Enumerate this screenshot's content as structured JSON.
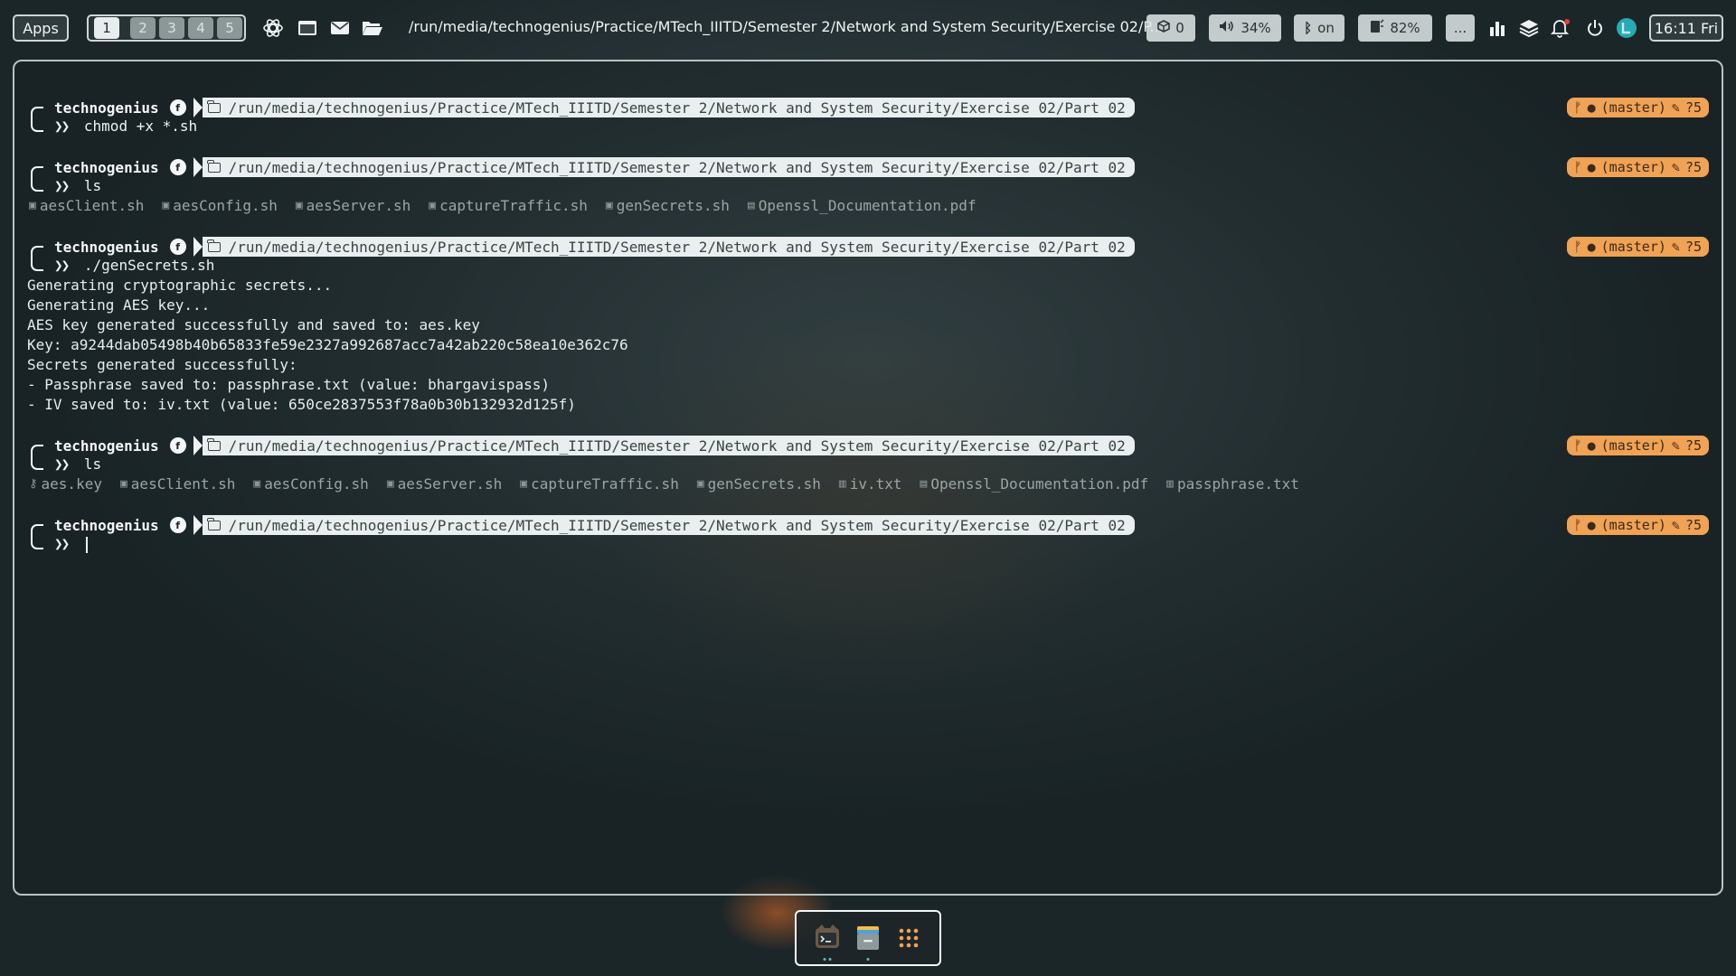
{
  "topbar": {
    "apps_label": "Apps",
    "workspaces": [
      "1",
      "2",
      "3",
      "4",
      "5"
    ],
    "active_workspace": "1",
    "launchers": [
      "openai-icon",
      "window-icon",
      "mail-icon",
      "folder-open-icon"
    ],
    "window_title": "/run/media/technogenius/Practice/MTech_IIITD/Semester 2/Network and System Security/Exercise 02/P...",
    "updates": "0",
    "volume": "34%",
    "bluetooth": "on",
    "brightness": "82%",
    "more": "...",
    "clock": "16:11 Fri"
  },
  "prompt": {
    "user": "technogenius",
    "path": "/run/media/technogenius/Practice/MTech_IIITD/Semester 2/Network and System Security/Exercise 02/Part 02",
    "git_branch": "(master)",
    "git_status": "?5",
    "symbol": "❯❯"
  },
  "blocks": [
    {
      "command": "chmod +x *.sh"
    },
    {
      "command": "ls",
      "files": [
        "aesClient.sh",
        "aesConfig.sh",
        "aesServer.sh",
        "captureTraffic.sh",
        "genSecrets.sh",
        "Openssl_Documentation.pdf"
      ]
    },
    {
      "command": "./genSecrets.sh",
      "output": [
        "Generating cryptographic secrets...",
        "Generating AES key...",
        "AES key generated successfully and saved to: aes.key",
        "Key: a9244dab05498b40b65833fe59e2327a992687acc7a42ab220c58ea10e362c76",
        "Secrets generated successfully:",
        "- Passphrase saved to: passphrase.txt (value: bhargavispass)",
        "- IV saved to: iv.txt (value: 650ce2837553f78a0b30b132932d125f)"
      ]
    },
    {
      "command": "ls",
      "files": [
        "aes.key",
        "aesClient.sh",
        "aesConfig.sh",
        "aesServer.sh",
        "captureTraffic.sh",
        "genSecrets.sh",
        "iv.txt",
        "Openssl_Documentation.pdf",
        "passphrase.txt"
      ]
    },
    {
      "command": ""
    }
  ],
  "dock": [
    "terminal-app-icon",
    "files-app-icon",
    "app-grid-icon"
  ],
  "colors": {
    "git_segment": "#f0a255",
    "path_segment": "#e9eeee",
    "accent": "#55c2c9"
  }
}
